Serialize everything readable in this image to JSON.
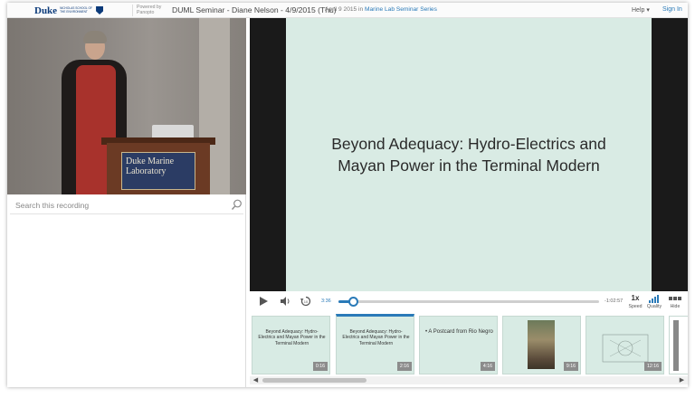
{
  "header": {
    "logo_text": "Duke",
    "logo_sub": "NICHOLAS SCHOOL of the ENVIRONMENT",
    "powered_by": "Powered by Panopto",
    "title": "DUML Seminar - Diane Nelson - 4/9/2015 (Thu)",
    "date_text": "April 9 2015 in",
    "series": "Marine Lab Seminar Series",
    "help": "Help ▾",
    "sign_in": "Sign In"
  },
  "presenter": {
    "podium_sign": "Duke Marine Laboratory"
  },
  "search": {
    "placeholder": "Search this recording"
  },
  "slide": {
    "title": "Beyond Adequacy: Hydro-Electrics and Mayan Power in the Terminal Modern"
  },
  "controls": {
    "current_time": "3:36",
    "remaining_time": "-1:02:57",
    "progress_fraction": 0.055,
    "speed_value": "1x",
    "speed_label": "Speed",
    "quality_label": "Quality",
    "hide_label": "Hide"
  },
  "thumbnails": [
    {
      "text": "Beyond Adequacy: Hydro-Electrics and Mayan Power in the Terminal Modern",
      "time": "0:16",
      "kind": "title"
    },
    {
      "text": "Beyond Adequacy: Hydro-Electrics and Mayan Power in the Terminal Modern",
      "time": "2:16",
      "kind": "title",
      "active": true
    },
    {
      "text": "• A Postcard from Rio Negro",
      "time": "4:16",
      "kind": "bullet"
    },
    {
      "text": "",
      "time": "9:16",
      "kind": "photo"
    },
    {
      "text": "",
      "time": "12:16",
      "kind": "diagram"
    }
  ],
  "colors": {
    "accent": "#2a7ab8",
    "slide_bg": "#d9ebe4",
    "player_bg": "#1a1a1a"
  }
}
